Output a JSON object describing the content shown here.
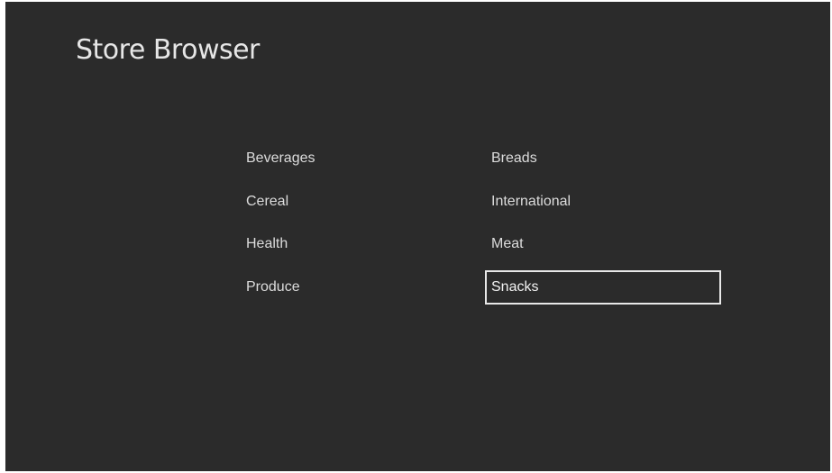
{
  "app": {
    "title": "Store Browser"
  },
  "categories": {
    "left": [
      "Beverages",
      "Cereal",
      "Health",
      "Produce"
    ],
    "right": [
      "Breads",
      "International",
      "Meat",
      "Snacks"
    ]
  },
  "selected_category": "Snacks",
  "colors": {
    "background": "#2b2b2b",
    "text": "#dcdcdc",
    "focus_border": "#e8e8e8"
  }
}
